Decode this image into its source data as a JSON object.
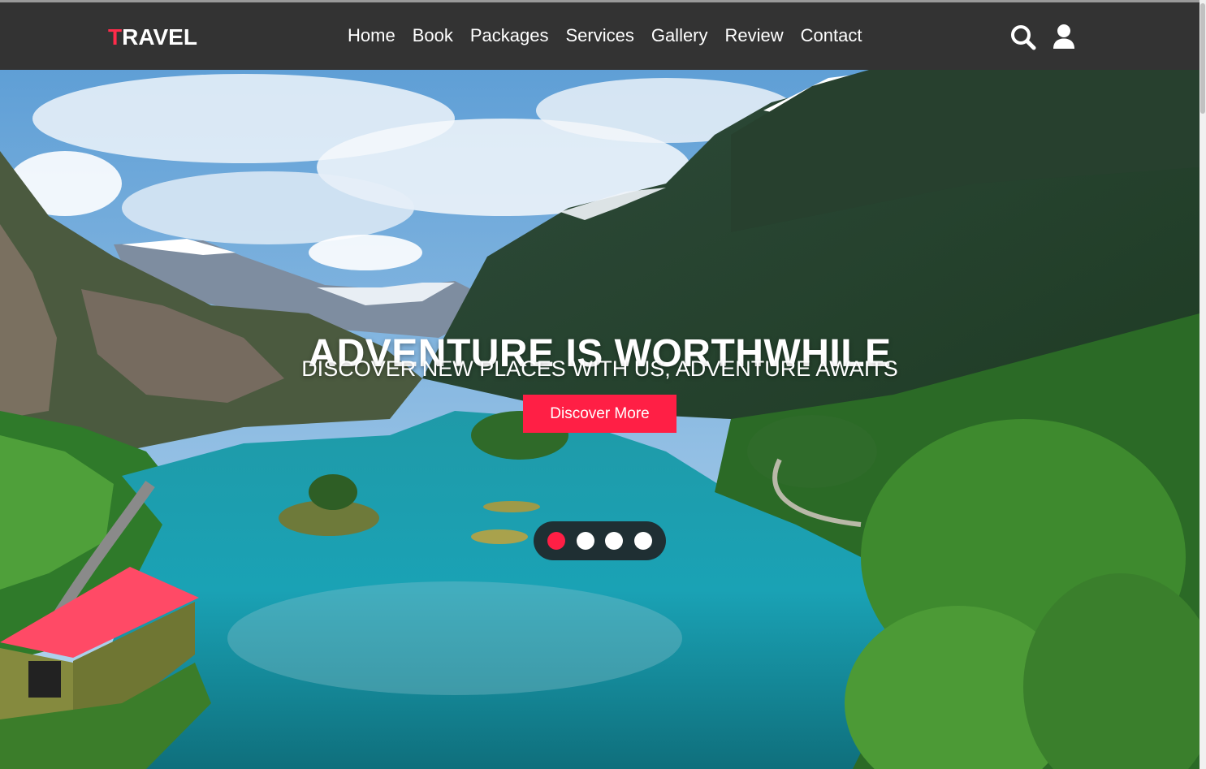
{
  "logo": {
    "first_letter": "T",
    "rest": "RAVEL"
  },
  "nav": {
    "items": [
      {
        "label": "Home"
      },
      {
        "label": "Book"
      },
      {
        "label": "Packages"
      },
      {
        "label": "Services"
      },
      {
        "label": "Gallery"
      },
      {
        "label": "Review"
      },
      {
        "label": "Contact"
      }
    ],
    "icons": [
      "search-icon",
      "user-icon"
    ]
  },
  "hero": {
    "title": "ADVENTURE IS WORTHWHILE",
    "subtitle": "DISCOVER NEW PLACES WITH US, ADVENTURE AWAITS",
    "button_label": "Discover More",
    "slides_count": 4,
    "active_slide": 1
  },
  "colors": {
    "accent": "#ff1f45",
    "navbar": "#333333",
    "dots_bg": "#1f2f33"
  }
}
